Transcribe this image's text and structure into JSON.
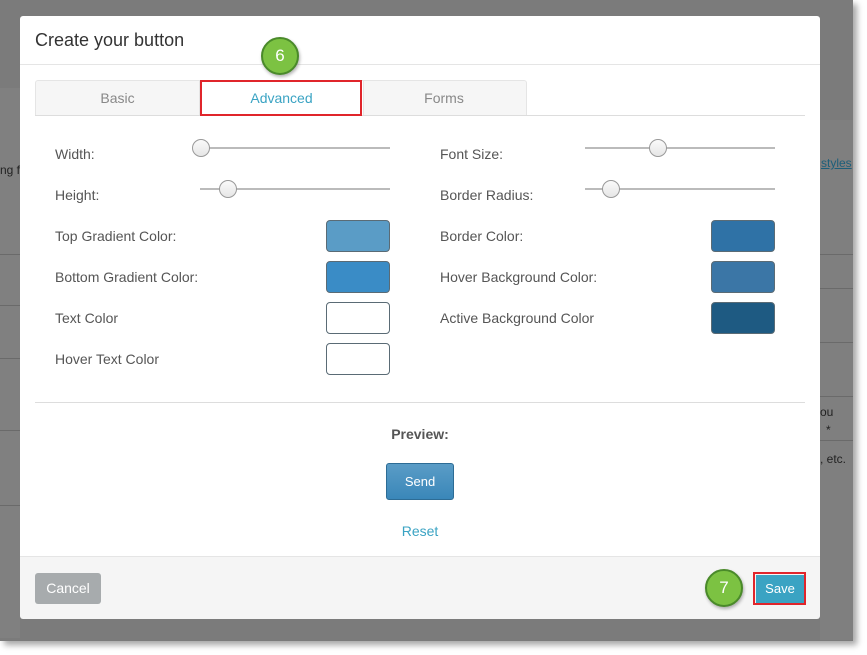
{
  "background": {
    "left_text": "ng f",
    "right_link": "styles",
    "right_text_1": "ou",
    "right_text_2": "*",
    "right_text_3": ", etc."
  },
  "modal": {
    "title": "Create your button"
  },
  "tabs": [
    {
      "label": "Basic",
      "active": false
    },
    {
      "label": "Advanced",
      "active": true
    },
    {
      "label": "Forms",
      "active": false
    }
  ],
  "callouts": {
    "step_6": "6",
    "step_7": "7"
  },
  "settings": {
    "width_label": "Width:",
    "width_value": 0.0,
    "height_label": "Height:",
    "height_value": 0.11,
    "font_size_label": "Font Size:",
    "font_size_value": 0.37,
    "border_radius_label": "Border Radius:",
    "border_radius_value": 0.1,
    "top_gradient_label": "Top Gradient Color:",
    "bottom_gradient_label": "Bottom Gradient Color:",
    "text_color_label": "Text Color",
    "hover_text_color_label": "Hover Text Color",
    "border_color_label": "Border Color:",
    "hover_bg_label": "Hover Background Color:",
    "active_bg_label": "Active Background Color"
  },
  "colors": {
    "top_gradient": "#5a9cc6",
    "bottom_gradient": "#3a8cc6",
    "text": "#ffffff",
    "hover_text": "#ffffff",
    "border": "#2f72a6",
    "hover_bg": "#3b76a6",
    "active_bg": "#1e5a82",
    "accent": "#3aa3c3",
    "highlight": "#e0252b",
    "callout": "#7cc242"
  },
  "preview": {
    "label": "Preview:",
    "button_label": "Send",
    "reset_label": "Reset"
  },
  "footer": {
    "cancel_label": "Cancel",
    "save_label": "Save"
  }
}
